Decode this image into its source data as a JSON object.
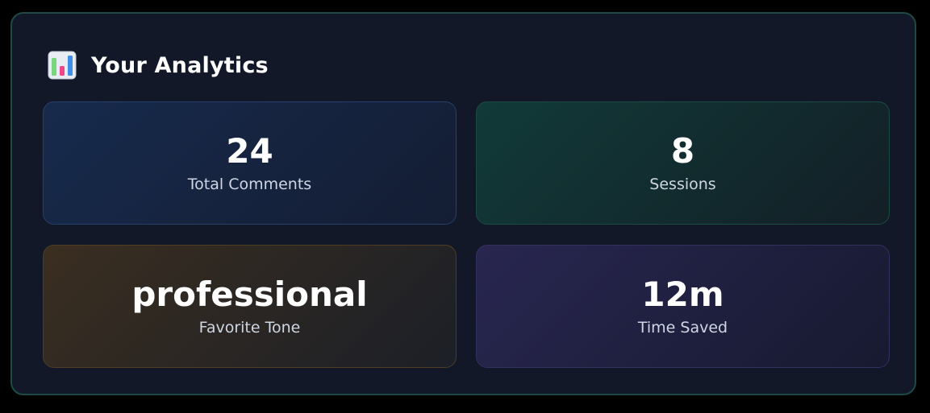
{
  "panel": {
    "title": "Your Analytics",
    "icon": "bar-chart-icon"
  },
  "stats": [
    {
      "value": "24",
      "label": "Total Comments"
    },
    {
      "value": "8",
      "label": "Sessions"
    },
    {
      "value": "professional",
      "label": "Favorite Tone"
    },
    {
      "value": "12m",
      "label": "Time Saved"
    }
  ],
  "colors": {
    "page_background": "#000000",
    "panel_background": "#121828",
    "panel_border": "#1d4a44",
    "comments_card": "#172a4c",
    "sessions_card": "#113a38",
    "tone_card": "#3a2e20",
    "time_card": "#282650"
  }
}
